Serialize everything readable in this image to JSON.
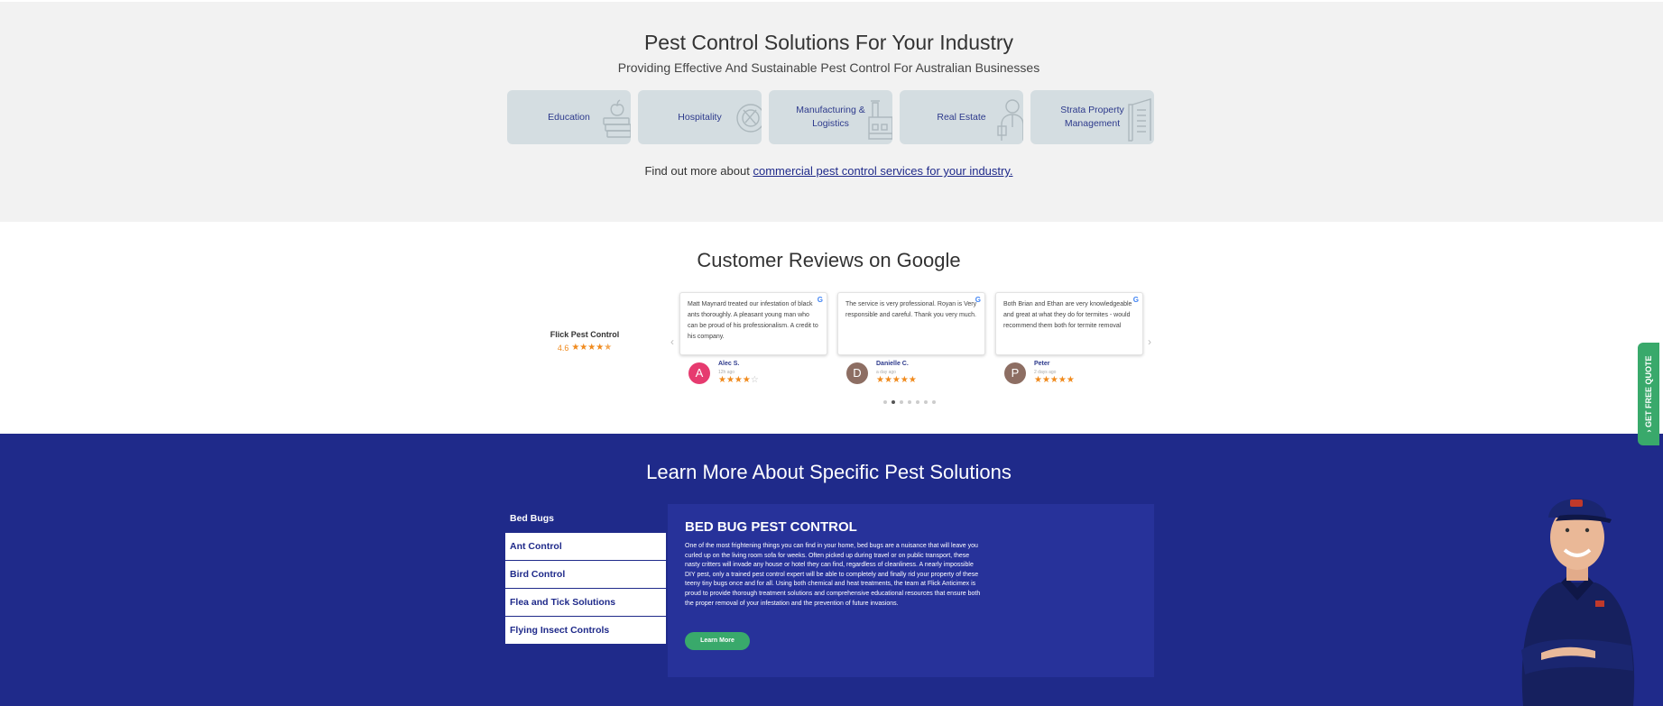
{
  "industry": {
    "title": "Pest Control Solutions For Your Industry",
    "subtitle": "Providing Effective And Sustainable Pest Control For Australian Businesses",
    "cards": [
      {
        "label": "Education",
        "icon": "books-apple-icon"
      },
      {
        "label": "Hospitality",
        "icon": "plate-cutlery-icon"
      },
      {
        "label": "Manufacturing & Logistics",
        "icon": "factory-icon"
      },
      {
        "label": "Real Estate",
        "icon": "realtor-icon"
      },
      {
        "label": "Strata Property Management",
        "icon": "building-icon"
      }
    ],
    "findout_prefix": "Find out more about",
    "findout_link": "commercial pest control services for your industry."
  },
  "reviews": {
    "title": "Customer Reviews on Google",
    "brand_name": "Flick Pest Control",
    "brand_rating": "4.6",
    "prev_arrow": "‹",
    "next_arrow": "›",
    "items": [
      {
        "text": "Matt Maynard treated our infestation of black ants thoroughly. A pleasant young man who can be proud of his professionalism. A credit to his company.",
        "name": "Alec S.",
        "time": "12h ago",
        "initial": "A",
        "avatar_color": "#e63b6f",
        "stars": 4
      },
      {
        "text": "The service is very professional. Royan is Very responsible and careful. Thank you very much.",
        "name": "Danielle C.",
        "time": "a day ago",
        "initial": "D",
        "avatar_color": "#8d6e63",
        "stars": 5
      },
      {
        "text": "Both Brian and Ethan are very knowledgeable and great at what they do for termites - would recommend them both for termite removal",
        "name": "Peter",
        "time": "2 days ago",
        "initial": "P",
        "avatar_color": "#8d6e63",
        "stars": 5
      }
    ],
    "dots_count": 7,
    "active_dot": 1
  },
  "pest": {
    "title": "Learn More About Specific Pest Solutions",
    "tabs": [
      "Bed Bugs",
      "Ant Control",
      "Bird Control",
      "Flea and Tick Solutions",
      "Flying Insect Controls"
    ],
    "active_tab": 0,
    "panel_title": "BED BUG PEST CONTROL",
    "panel_text": "One of the most frightening things you can find in your home, bed bugs are a nuisance that will leave you curled up on the living room sofa for weeks. Often picked up during travel or on public transport, these nasty critters will invade any house or hotel they can find, regardless of cleanliness. A nearly impossible DIY pest, only a trained pest control expert will be able to completely and finally rid your property of these teeny tiny bugs once and for all. Using both chemical and heat treatments, the team at Flick Anticimex is proud to provide thorough treatment solutions and comprehensive educational resources that ensure both the proper removal of your infestation and the prevention of future invasions.",
    "learn_more": "Learn More"
  },
  "quote_tab": "› GET FREE QUOTE",
  "colors": {
    "navy": "#1f2a8a",
    "green": "#39a96b",
    "star": "#f08a1d"
  }
}
